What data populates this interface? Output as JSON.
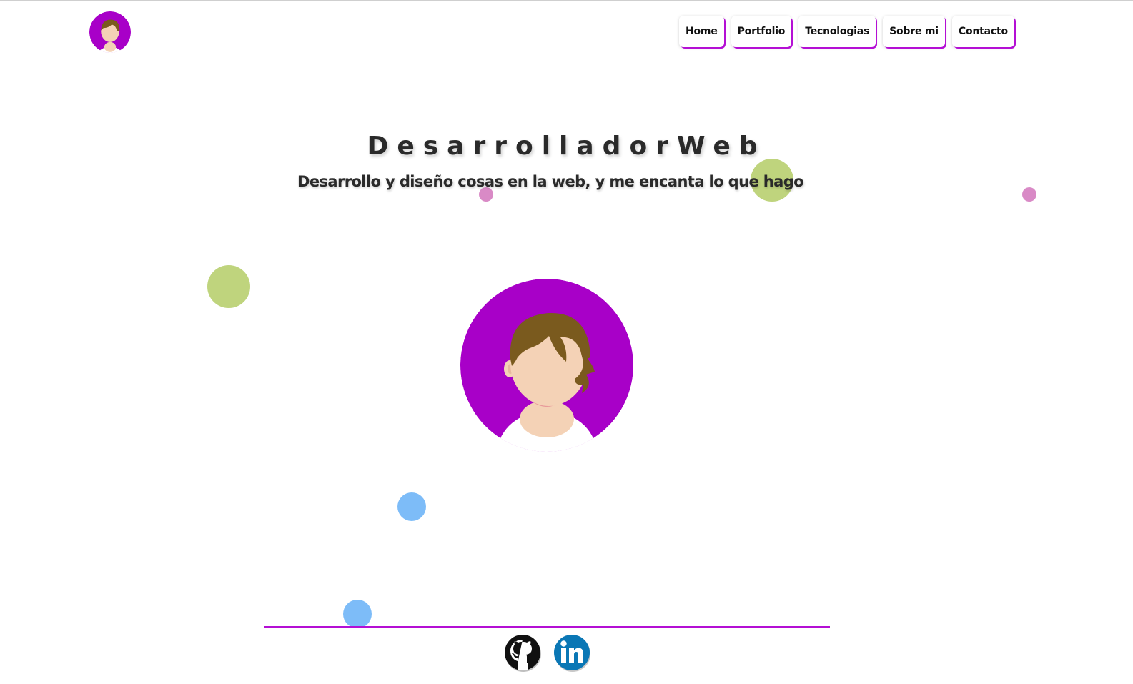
{
  "header": {
    "logo_icon": "avatar-girl-icon",
    "nav": [
      {
        "label": "Home"
      },
      {
        "label": "Portfolio"
      },
      {
        "label": "Tecnologias"
      },
      {
        "label": "Sobre mi"
      },
      {
        "label": "Contacto"
      }
    ]
  },
  "hero": {
    "title": "DesarrolladorWeb",
    "subtitle": "Desarrollo y diseño cosas en la web, y me encanta lo que hago",
    "avatar_icon": "avatar-girl-icon"
  },
  "footer": {
    "social": [
      {
        "icon": "github-icon"
      },
      {
        "icon": "linkedin-icon"
      }
    ]
  },
  "colors": {
    "accent": "#b40fd4",
    "avatar_bg": "#a800c8",
    "dot_green": "#bcd276",
    "dot_pink": "#d98ac6",
    "dot_blue": "#7dbcf8",
    "linkedin": "#0a77b5"
  }
}
